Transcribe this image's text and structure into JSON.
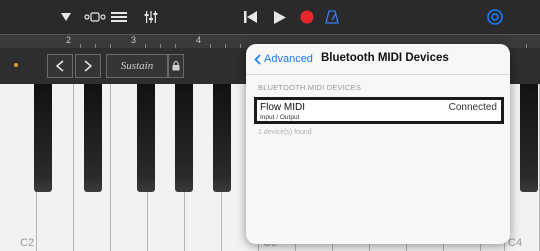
{
  "toolbar": {
    "icons": [
      "dropdown-triangle-icon",
      "loop-browser-icon",
      "tracks-view-icon",
      "mixer-icon",
      "rewind-icon",
      "play-icon",
      "record-icon",
      "metronome-icon",
      "settings-icon"
    ]
  },
  "ruler": {
    "numbers": [
      "2",
      "3",
      "4"
    ]
  },
  "controls": {
    "sustain_label": "Sustain"
  },
  "keyboard": {
    "labels": [
      "C2",
      "C3",
      "C4"
    ]
  },
  "popover": {
    "back_label": "Advanced",
    "title": "Bluetooth MIDI Devices",
    "section_header": "BLUETOOTH MIDI DEVICES",
    "device": {
      "name": "Flow MIDI",
      "type": "Input / Output",
      "status": "Connected"
    },
    "footnote": "1 device(s) found"
  },
  "colors": {
    "accent": "#1a7cf5",
    "record": "#e8262c",
    "popover_bg": "#f7f7f7"
  }
}
